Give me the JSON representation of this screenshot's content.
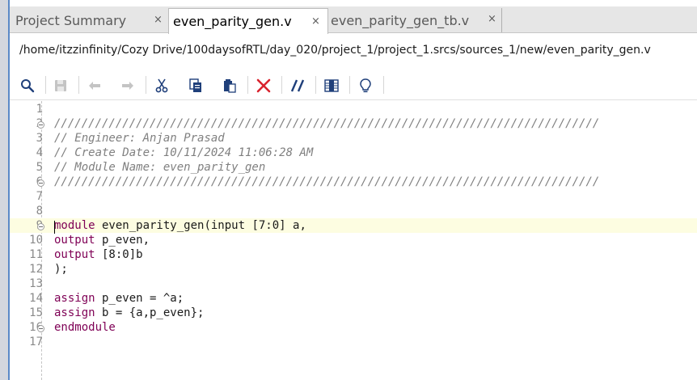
{
  "tabs": [
    {
      "label": "Project Summary",
      "close": "×",
      "active": false
    },
    {
      "label": "even_parity_gen.v",
      "close": "×",
      "active": true
    },
    {
      "label": "even_parity_gen_tb.v",
      "close": "×",
      "active": false
    }
  ],
  "file_path": "/home/itzzinfinity/Cozy Drive/100daysofRTL/day_020/project_1/project_1.srcs/sources_1/new/even_parity_gen.v",
  "toolbar": {
    "icons": [
      "search-icon",
      "save-icon",
      "undo-icon",
      "redo-icon",
      "cut-icon",
      "copy-icon",
      "paste-icon",
      "delete-icon",
      "comment-toggle-icon",
      "column-select-icon",
      "hint-icon"
    ],
    "delete_color": "#d9232e",
    "accent_color": "#1f3f7a"
  },
  "editor": {
    "current_line": 9,
    "lines": [
      {
        "n": "1",
        "text": ""
      },
      {
        "n": "2",
        "text": "////////////////////////////////////////////////////////////////////////////////"
      },
      {
        "n": "3",
        "text": "// Engineer: Anjan Prasad"
      },
      {
        "n": "4",
        "text": "// Create Date: 10/11/2024 11:06:28 AM"
      },
      {
        "n": "5",
        "text": "// Module Name: even_parity_gen"
      },
      {
        "n": "6",
        "text": "////////////////////////////////////////////////////////////////////////////////"
      },
      {
        "n": "7",
        "text": ""
      },
      {
        "n": "8",
        "text": ""
      },
      {
        "n": "9",
        "kw": "module",
        "rest": " even_parity_gen(input [7:0] a,"
      },
      {
        "n": "10",
        "kw": "output",
        "rest": " p_even,"
      },
      {
        "n": "11",
        "kw": "output",
        "rest": " [8:0]b"
      },
      {
        "n": "12",
        "text": ");"
      },
      {
        "n": "13",
        "text": ""
      },
      {
        "n": "14",
        "kw": "assign",
        "rest": " p_even = ^a;"
      },
      {
        "n": "15",
        "kw": "assign",
        "rest": " b = {a,p_even};"
      },
      {
        "n": "16",
        "kw": "endmodule",
        "rest": ""
      },
      {
        "n": "17",
        "text": ""
      }
    ]
  }
}
